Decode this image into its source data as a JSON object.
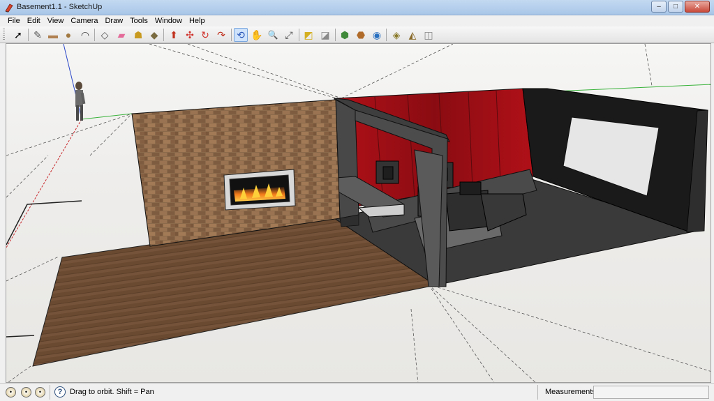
{
  "window": {
    "title": "Basement1.1 - SketchUp",
    "buttons": {
      "minimize": "–",
      "maximize": "□",
      "close": "✕"
    }
  },
  "menu": [
    "File",
    "Edit",
    "View",
    "Camera",
    "Draw",
    "Tools",
    "Window",
    "Help"
  ],
  "toolbar": {
    "tools": [
      {
        "name": "select-tool",
        "glyph": "➚"
      },
      {
        "name": "pencil-tool",
        "glyph": "✎"
      },
      {
        "name": "rectangle-tool",
        "glyph": "▬"
      },
      {
        "name": "circle-tool",
        "glyph": "●"
      },
      {
        "name": "arc-tool",
        "glyph": "◠"
      },
      {
        "name": "make-component-tool",
        "glyph": "◇"
      },
      {
        "name": "eraser-tool",
        "glyph": "▰"
      },
      {
        "name": "tape-measure-tool",
        "glyph": "☗"
      },
      {
        "name": "paint-bucket-tool",
        "glyph": "◆"
      },
      {
        "name": "push-pull-tool",
        "glyph": "⬆"
      },
      {
        "name": "move-tool",
        "glyph": "✣"
      },
      {
        "name": "rotate-tool",
        "glyph": "↻"
      },
      {
        "name": "follow-me-tool",
        "glyph": "↷"
      },
      {
        "name": "orbit-tool",
        "glyph": "⟲",
        "active": true
      },
      {
        "name": "pan-tool",
        "glyph": "✋"
      },
      {
        "name": "zoom-tool",
        "glyph": "🔍"
      },
      {
        "name": "zoom-extents-tool",
        "glyph": "⤢"
      },
      {
        "name": "previous-view-tool",
        "glyph": "◩"
      },
      {
        "name": "next-view-tool",
        "glyph": "◪"
      },
      {
        "name": "get-models-tool",
        "glyph": "⬢"
      },
      {
        "name": "share-model-tool",
        "glyph": "⬣"
      },
      {
        "name": "google-earth-tool",
        "glyph": "◉"
      },
      {
        "name": "get-current-view-tool",
        "glyph": "◈"
      },
      {
        "name": "toggle-terrain-tool",
        "glyph": "◭"
      },
      {
        "name": "place-model-tool",
        "glyph": "◫"
      }
    ]
  },
  "status": {
    "hint": "Drag to orbit.  Shift = Pan",
    "measurements_label": "Measurements",
    "measurements_value": ""
  },
  "colors": {
    "red_axis": "#c8282c",
    "green_axis": "#38b23a",
    "blue_axis": "#2a46c8",
    "brick": "#8a6848",
    "wood_floor": "#6b4a30",
    "accent_red": "#a0141a",
    "dark_room": "#2a2a2a"
  }
}
